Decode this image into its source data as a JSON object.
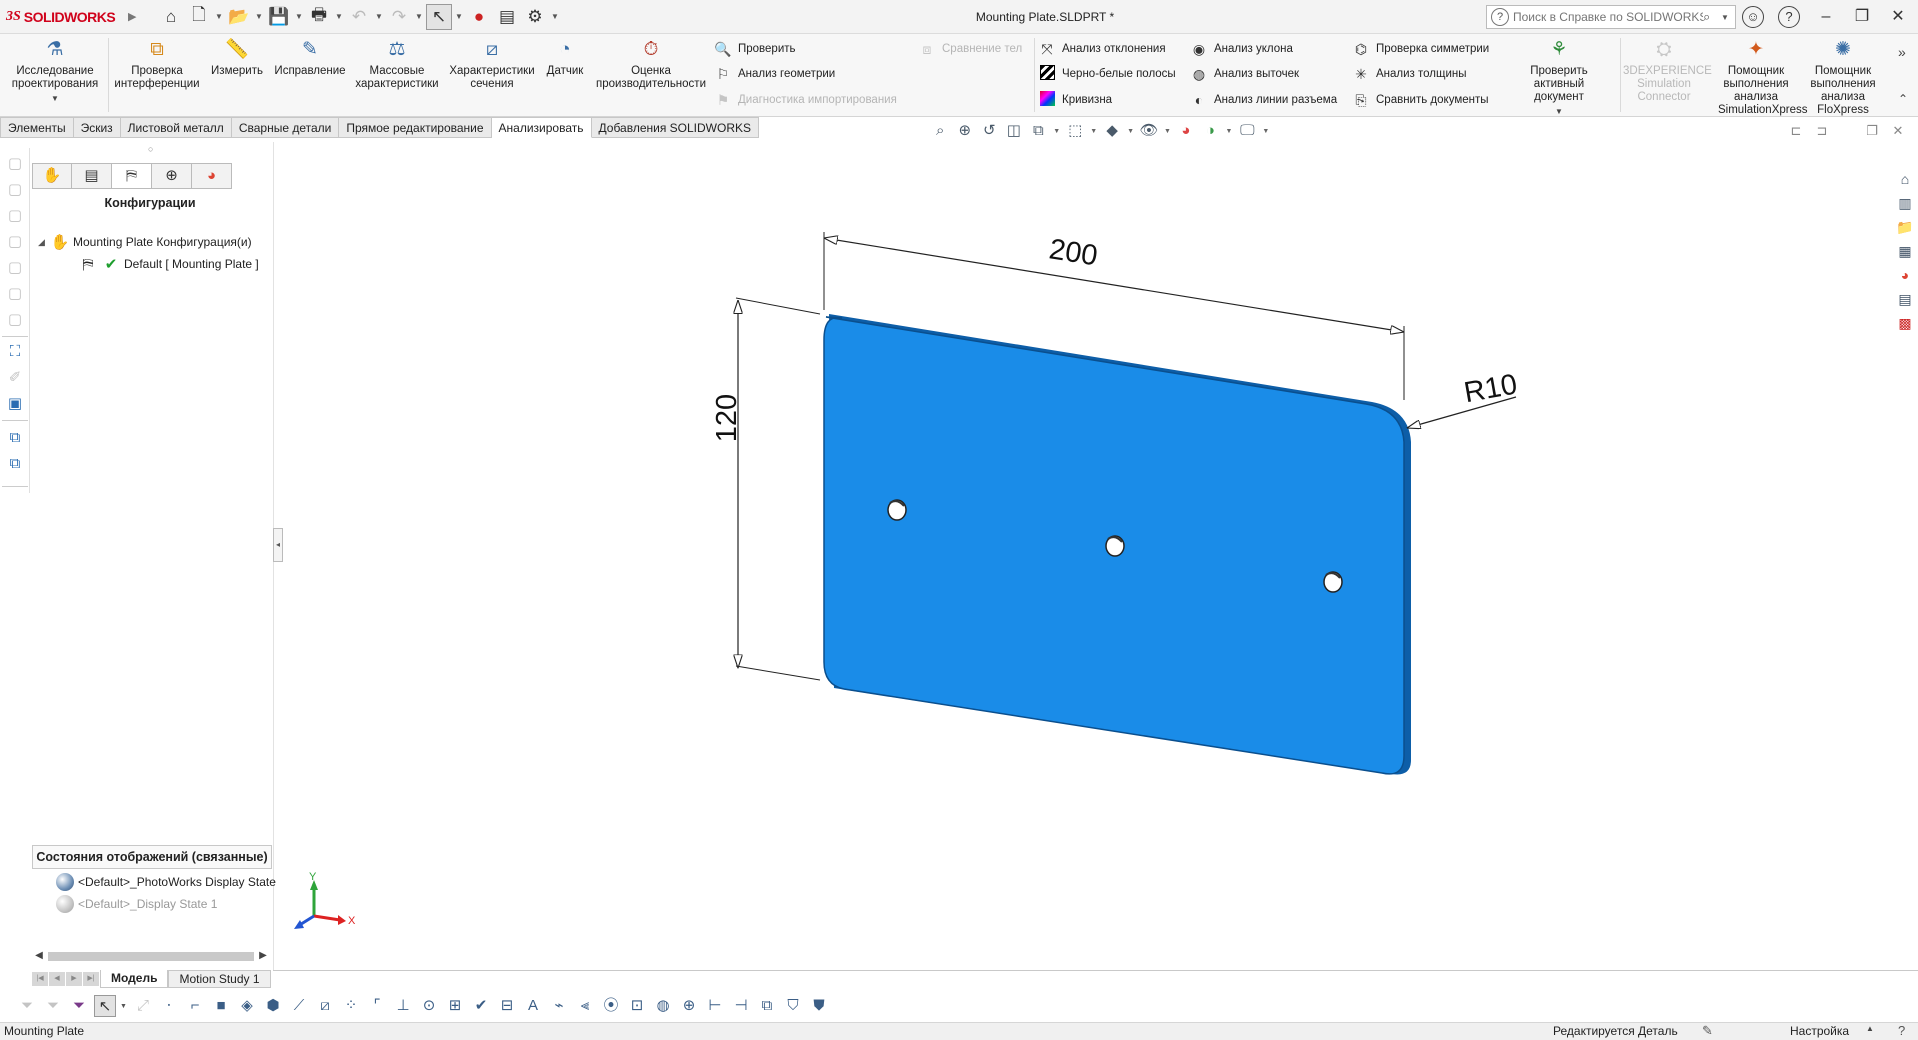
{
  "titlebar": {
    "brand": "SOLIDWORKS",
    "document_title": "Mounting Plate.SLDPRT *",
    "search_placeholder": "Поиск в Справке по SOLIDWORKS"
  },
  "commands": {
    "large": [
      {
        "label": "Исследование проектирования"
      },
      {
        "label": "Проверка интерференции"
      },
      {
        "label": "Измерить"
      },
      {
        "label": "Исправление"
      },
      {
        "label": "Массовые характеристики"
      },
      {
        "label": "Характеристики сечения"
      },
      {
        "label": "Датчик"
      },
      {
        "label": "Оценка производительности"
      }
    ],
    "check": "Проверить",
    "geometry_analysis": "Анализ геометрии",
    "import_diagnostics": "Диагностика импортирования",
    "compare_bodies": "Сравнение тел",
    "deviation_analysis": "Анализ отклонения",
    "zebra_stripes": "Черно-белые полосы",
    "curvature": "Кривизна",
    "draft_analysis": "Анализ уклона",
    "undercut_analysis": "Анализ выточек",
    "parting_line_analysis": "Анализ линии разъема",
    "symmetry_check": "Проверка симметрии",
    "thickness_analysis": "Анализ толщины",
    "compare_documents": "Сравнить документы",
    "check_active_document": "Проверить активный документ",
    "simulation_connector": "3DEXPERIENCE Simulation Connector",
    "simxpress": "Помощник выполнения анализа SimulationXpress",
    "floxpress": "Помощник выполнения анализа FloXpress"
  },
  "tabs": [
    {
      "label": "Элементы",
      "active": false
    },
    {
      "label": "Эскиз",
      "active": false
    },
    {
      "label": "Листовой металл",
      "active": false
    },
    {
      "label": "Сварные детали",
      "active": false
    },
    {
      "label": "Прямое редактирование",
      "active": false
    },
    {
      "label": "Анализировать",
      "active": true
    },
    {
      "label": "Добавления SOLIDWORKS",
      "active": false
    }
  ],
  "feature_manager": {
    "panel_title": "Конфигурации",
    "root": "Mounting Plate Конфигурация(и)",
    "config": "Default [ Mounting Plate ]",
    "display_states_title": "Состояния отображений (связанные)",
    "display_state_1": "<Default>_PhotoWorks Display State",
    "display_state_2": "<Default>_Display State 1"
  },
  "model_tabs": {
    "model": "Модель",
    "motion": "Motion Study 1"
  },
  "dimensions": {
    "width": "200",
    "height": "120",
    "radius": "R10"
  },
  "part": {
    "face_color": "#1a8ce8",
    "edge_color": "#0a4f8e",
    "hole_count": 3
  },
  "triad": {
    "x": "X",
    "y": "Y"
  },
  "status": {
    "left": "Mounting Plate",
    "mode": "Редактируется Деталь",
    "units": "Настройка"
  }
}
